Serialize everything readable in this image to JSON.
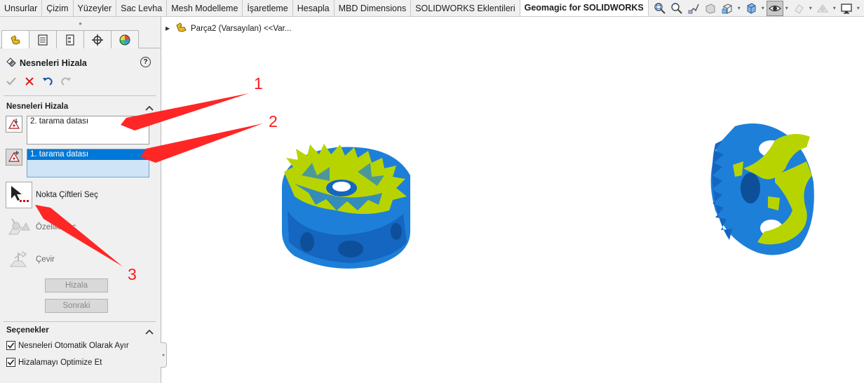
{
  "toolbar": {
    "tabs": [
      {
        "label": "Unsurlar"
      },
      {
        "label": "Çizim"
      },
      {
        "label": "Yüzeyler"
      },
      {
        "label": "Sac Levha"
      },
      {
        "label": "Mesh Modelleme"
      },
      {
        "label": "İşaretleme"
      },
      {
        "label": "Hesapla"
      },
      {
        "label": "MBD Dimensions"
      },
      {
        "label": "SOLIDWORKS Eklentileri"
      },
      {
        "label": "Geomagic for SOLIDWORKS"
      }
    ],
    "active_tab": "Geomagic for SOLIDWORKS",
    "view_icons": [
      "zoom-to-fit-icon",
      "zoom-to-area-icon",
      "previous-view-icon",
      "section-view-icon",
      "view-orientation-icon",
      "display-style-icon",
      "hide-show-items-icon",
      "edit-appearance-icon",
      "apply-scene-icon",
      "view-settings-icon"
    ]
  },
  "feature_tree": {
    "item_label": "Parça2 (Varsayılan) <<Var..."
  },
  "property_manager": {
    "title": "Nesneleri Hizala",
    "help_label": "?",
    "group_align": {
      "title": "Nesneleri Hizala",
      "fixed_list_items": [
        "2. tarama datası"
      ],
      "moving_list_items": [
        "1. tarama datası"
      ],
      "tools": [
        {
          "label": "Nokta Çiftleri Seç",
          "enabled": true
        },
        {
          "label": "Özellik Seç",
          "enabled": false
        },
        {
          "label": "Çevir",
          "enabled": false
        }
      ],
      "align_button": "Hizala",
      "next_button": "Sonraki"
    },
    "group_options": {
      "title": "Seçenekler",
      "options": [
        {
          "label": "Nesneleri Otomatik Olarak Ayır",
          "checked": true
        },
        {
          "label": "Hizalamayı Optimize Et",
          "checked": true
        }
      ]
    }
  },
  "annotations": {
    "labels": [
      "1",
      "2",
      "3"
    ],
    "color": "#ff1a1a"
  },
  "colors": {
    "scan_blue": "#1e7fd8",
    "scan_yellow": "#b8d400",
    "selection_blue": "#0078d7"
  }
}
